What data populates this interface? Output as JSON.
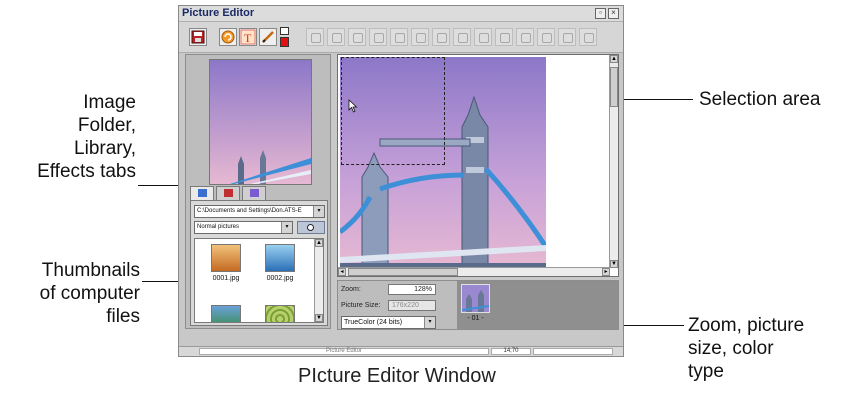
{
  "callouts": {
    "tabs_lines": [
      "Image",
      "Folder,",
      "Library,",
      "Effects tabs"
    ],
    "thumbnails_lines": [
      "Thumbnails",
      "of computer",
      "files"
    ],
    "selection": "Selection area",
    "zoom_lines": [
      "Zoom, picture",
      "size, color",
      "type"
    ]
  },
  "caption": "PIcture Editor Window",
  "window": {
    "title": "Picture Editor",
    "folder_path": "C:\\Documents and Settings\\Don.ATS-E",
    "filter": "Normal pictures",
    "thumbnails": [
      {
        "name": "0001.jpg"
      },
      {
        "name": "0002.jpg"
      }
    ],
    "zoom_label": "Zoom:",
    "zoom_value": "128%",
    "size_label": "Picture Size:",
    "size_value": "176x220",
    "color_type": "TrueColor (24 bits)",
    "film_caption": "- 01 -",
    "status_left": "Picture Editor",
    "status_right": "14,70"
  },
  "colors": {
    "sky_top": "#8c77c8",
    "sky_bottom": "#e6b8d2",
    "bridge_blue": "#3d8fd8"
  }
}
